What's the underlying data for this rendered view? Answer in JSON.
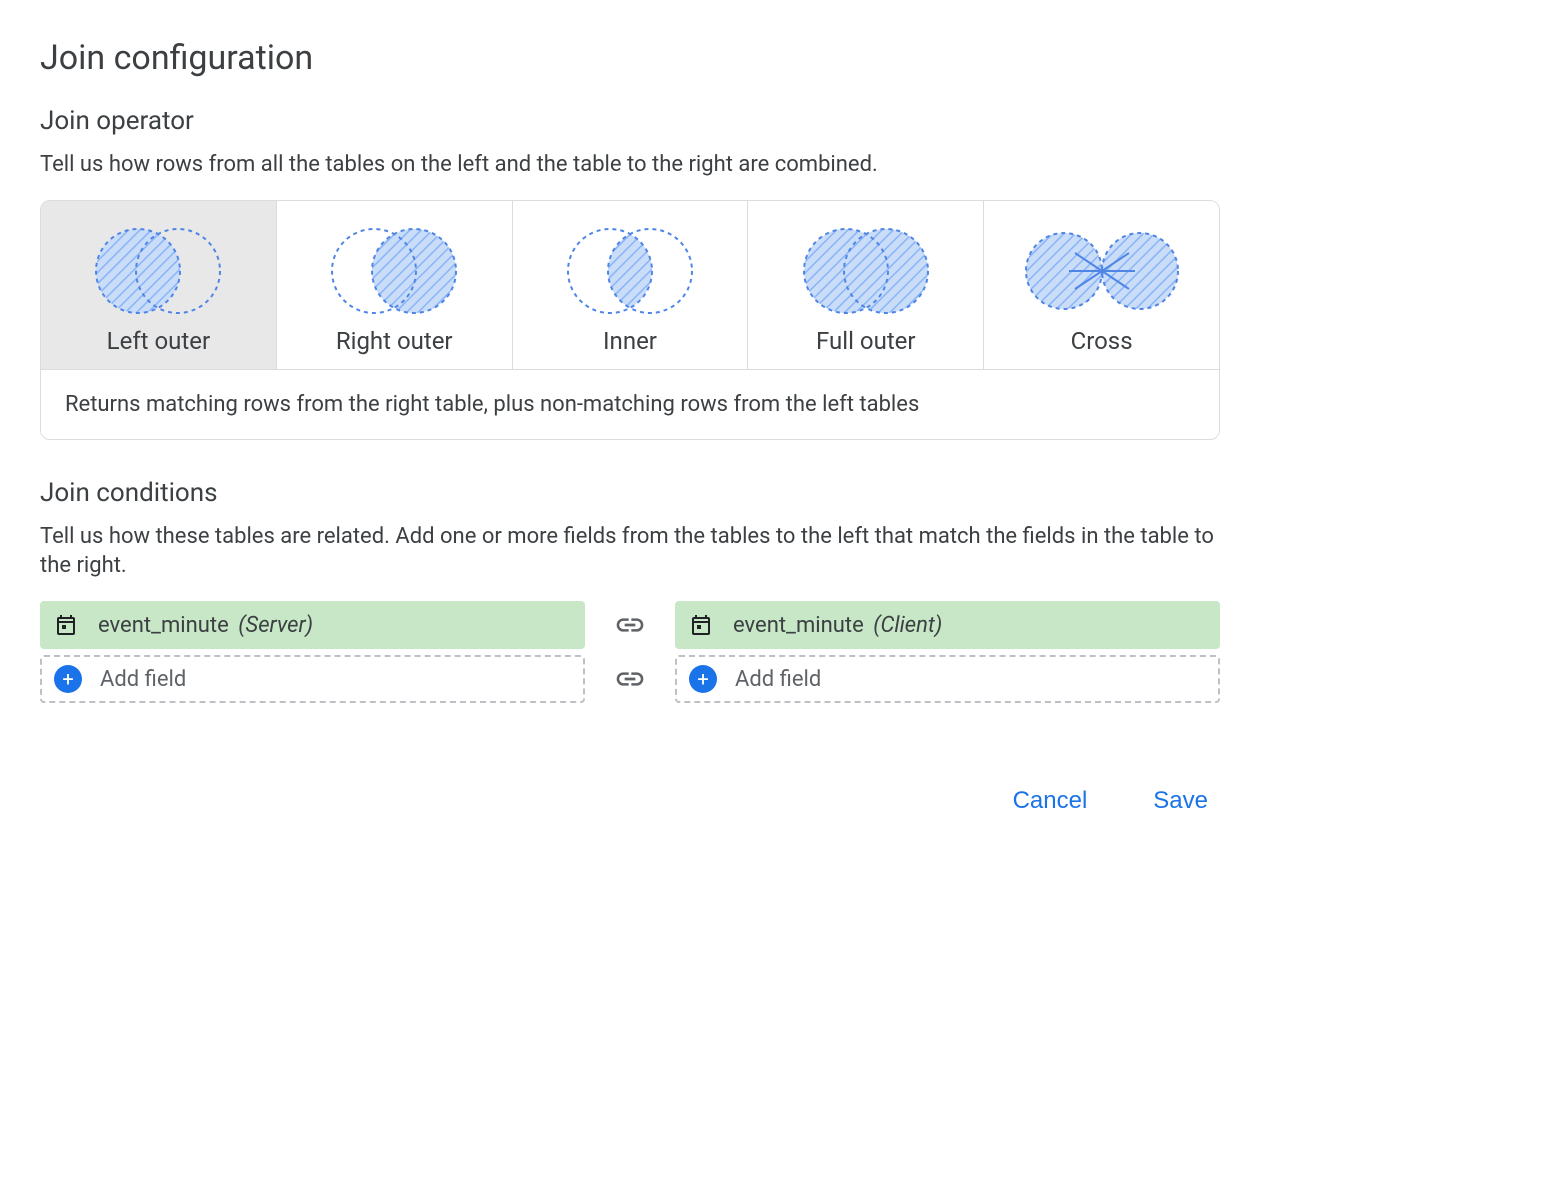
{
  "title": "Join configuration",
  "operator": {
    "heading": "Join operator",
    "description": "Tell us how rows from all the tables on the left and the table to the right are combined.",
    "options": [
      {
        "id": "left-outer",
        "label": "Left outer",
        "selected": true
      },
      {
        "id": "right-outer",
        "label": "Right outer",
        "selected": false
      },
      {
        "id": "inner",
        "label": "Inner",
        "selected": false
      },
      {
        "id": "full-outer",
        "label": "Full outer",
        "selected": false
      },
      {
        "id": "cross",
        "label": "Cross",
        "selected": false
      }
    ],
    "selected_description": "Returns matching rows from the right table, plus non-matching rows from the left tables"
  },
  "conditions": {
    "heading": "Join conditions",
    "description": "Tell us how these tables are related. Add one or more fields from the tables to the left that match the fields in the table to the right.",
    "rows": [
      {
        "left": {
          "field": "event_minute",
          "source": "(Server)"
        },
        "right": {
          "field": "event_minute",
          "source": "(Client)"
        }
      }
    ],
    "add_label": "Add field"
  },
  "actions": {
    "cancel": "Cancel",
    "save": "Save"
  }
}
